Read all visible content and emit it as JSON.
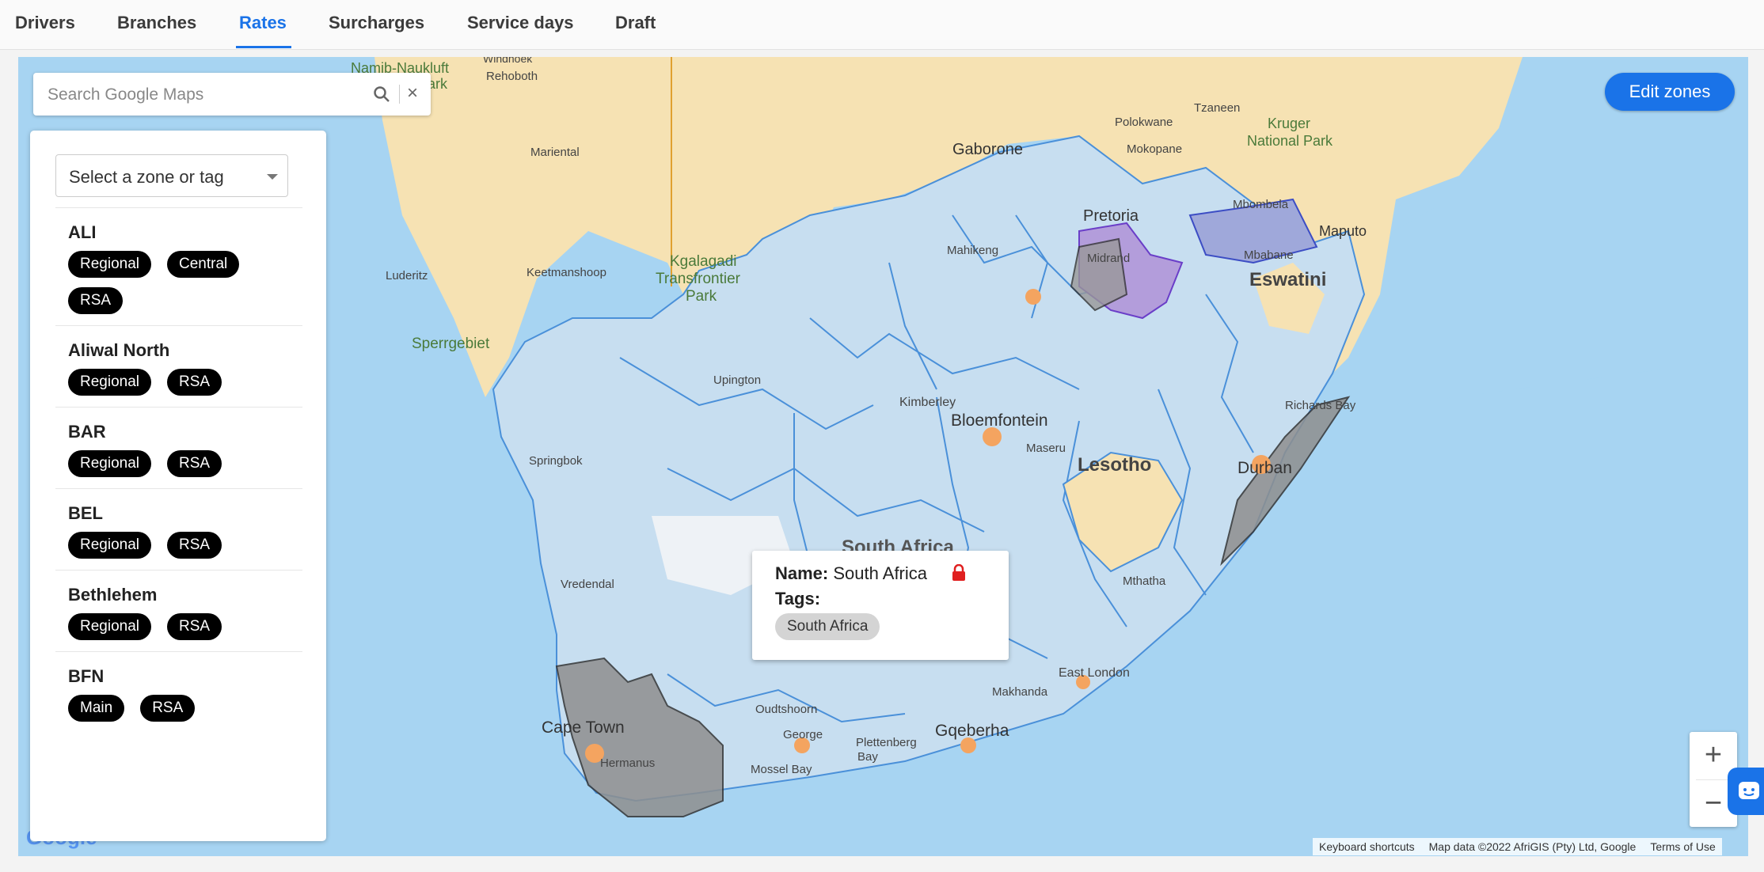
{
  "tabs": [
    "Drivers",
    "Branches",
    "Rates",
    "Surcharges",
    "Service days",
    "Draft"
  ],
  "active_tab": "Rates",
  "search": {
    "placeholder": "Search Google Maps",
    "clear": "×"
  },
  "edit_button": "Edit zones",
  "zone_select": {
    "placeholder": "Select a zone or tag"
  },
  "zones": [
    {
      "name": "ALI",
      "tags": [
        "Regional",
        "Central",
        "RSA"
      ]
    },
    {
      "name": "Aliwal North",
      "tags": [
        "Regional",
        "RSA"
      ]
    },
    {
      "name": "BAR",
      "tags": [
        "Regional",
        "RSA"
      ]
    },
    {
      "name": "BEL",
      "tags": [
        "Regional",
        "RSA"
      ]
    },
    {
      "name": "Bethlehem",
      "tags": [
        "Regional",
        "RSA"
      ]
    },
    {
      "name": "BFN",
      "tags": [
        "Main",
        "RSA"
      ]
    }
  ],
  "popup": {
    "name_label": "Name:",
    "name_value": "South Africa",
    "tags_label": "Tags:",
    "tag": "South Africa"
  },
  "zoom": {
    "in": "+",
    "out": "−"
  },
  "attribution": {
    "shortcuts": "Keyboard shortcuts",
    "data": "Map data ©2022 AfriGIS (Pty) Ltd, Google",
    "terms": "Terms of Use"
  },
  "map_labels": {
    "namib": "Namib-Naukluft",
    "park": "Park",
    "windhoek": "Windhoek",
    "rehoboth": "Rehoboth",
    "mariental": "Mariental",
    "gaborone": "Gaborone",
    "polokwane": "Polokwane",
    "tzaneen": "Tzaneen",
    "kruger": "Kruger",
    "national_park": "National Park",
    "mokopane": "Mokopane",
    "pretoria": "Pretoria",
    "mbombela": "Mbombela",
    "maputo": "Maputo",
    "mahikeng": "Mahikeng",
    "midrand": "Midrand",
    "mbabane": "Mbabane",
    "eswatini": "Eswatini",
    "kgalagadi": "Kgalagadi",
    "transfrontier": "Transfrontier",
    "kpark": "Park",
    "luderitz": "Luderitz",
    "keetmanshoop": "Keetmanshoop",
    "sperrgebiet": "Sperrgebiet",
    "upington": "Upington",
    "kimberley": "Kimberley",
    "bloemfontein": "Bloemfontein",
    "maseru": "Maseru",
    "lesotho": "Lesotho",
    "richards_bay": "Richards Bay",
    "springbok": "Springbok",
    "durban": "Durban",
    "south_africa": "South Africa",
    "vredendal": "Vredendal",
    "mthatha": "Mthatha",
    "east_london": "East London",
    "makhanda": "Makhanda",
    "oudtshoorn": "Oudtshoorn",
    "cape_town": "Cape Town",
    "george": "George",
    "gqeberha": "Gqeberha",
    "plettenberg": "Plettenberg",
    "bay": "Bay",
    "hermanus": "Hermanus",
    "mossel_bay": "Mossel Bay",
    "google": "Google"
  }
}
